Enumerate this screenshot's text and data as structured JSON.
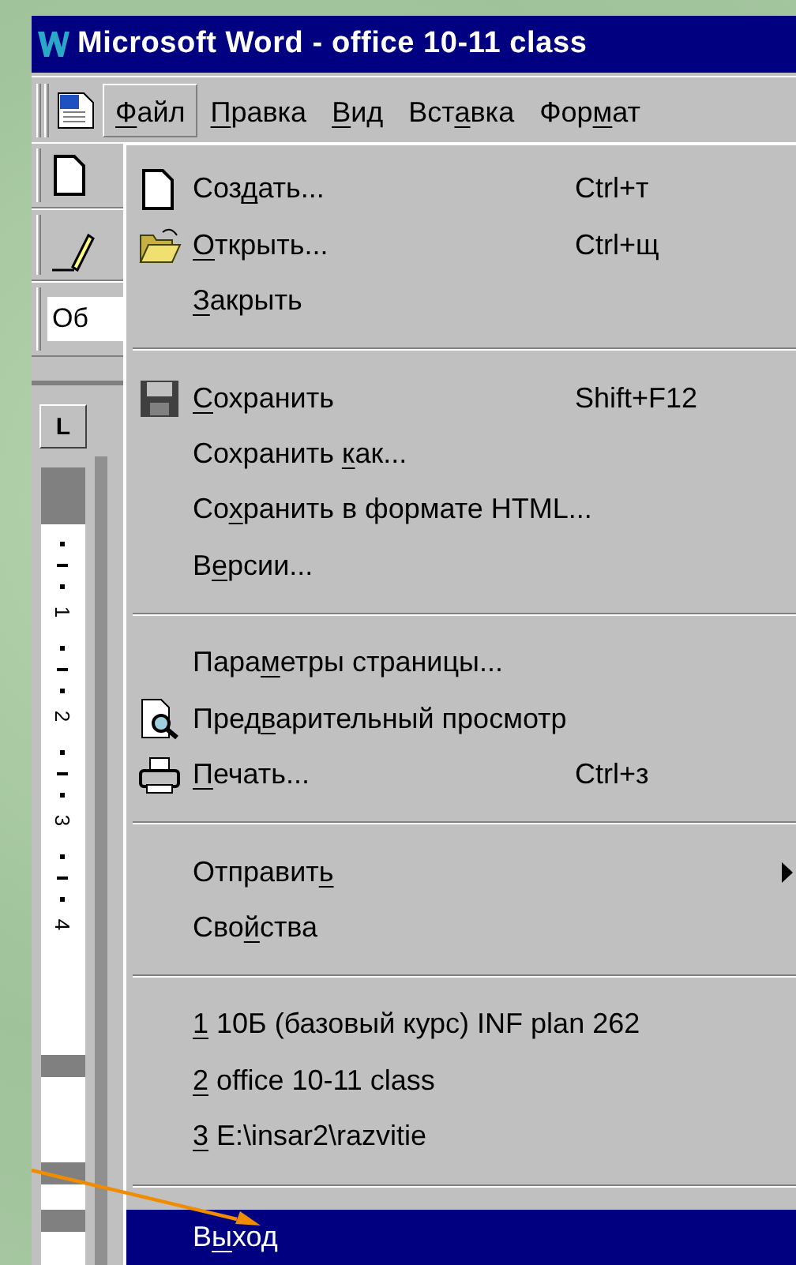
{
  "window": {
    "title": "Microsoft Word - office 10-11 class"
  },
  "menu_bar": [
    {
      "key": "Ф",
      "post": "айл",
      "selected": true
    },
    {
      "key": "П",
      "post": "равка",
      "selected": false
    },
    {
      "key": "В",
      "post": "ид",
      "selected": false
    },
    {
      "pre": "Вст",
      "key": "а",
      "post": "вка",
      "selected": false
    },
    {
      "pre": "Фор",
      "key": "м",
      "post": "ат",
      "selected": false
    }
  ],
  "format_field": {
    "value": "Об"
  },
  "ruler": {
    "tab_button": "L",
    "numbers": [
      "1",
      "2",
      "3",
      "4"
    ]
  },
  "file_menu": [
    {
      "kind": "item",
      "pre": "Соз",
      "key": "д",
      "post": "ать...",
      "shortcut": "Ctrl+т",
      "submenu": false,
      "selected": false
    },
    {
      "kind": "item",
      "key": "О",
      "post": "ткрыть...",
      "shortcut": "Ctrl+щ",
      "submenu": false,
      "selected": false
    },
    {
      "kind": "item",
      "key": "З",
      "post": "акрыть",
      "submenu": false,
      "selected": false
    },
    {
      "kind": "separator"
    },
    {
      "kind": "item",
      "key": "С",
      "post": "охранить",
      "shortcut": "Shift+F12",
      "submenu": false,
      "selected": false
    },
    {
      "kind": "item",
      "pre": "Сохранить ",
      "key": "к",
      "post": "ак...",
      "submenu": false,
      "selected": false
    },
    {
      "kind": "item",
      "pre": "Со",
      "key": "х",
      "post": "ранить в формате HTML...",
      "submenu": false,
      "selected": false
    },
    {
      "kind": "item",
      "pre": "В",
      "key": "е",
      "post": "рсии...",
      "submenu": false,
      "selected": false
    },
    {
      "kind": "separator"
    },
    {
      "kind": "item",
      "pre": "Пара",
      "key": "м",
      "post": "етры страницы...",
      "submenu": false,
      "selected": false
    },
    {
      "kind": "item",
      "pre": "Пред",
      "key": "в",
      "post": "арительный просмотр",
      "submenu": false,
      "selected": false
    },
    {
      "kind": "item",
      "key": "П",
      "post": "ечать...",
      "shortcut": "Ctrl+з",
      "submenu": false,
      "selected": false
    },
    {
      "kind": "separator"
    },
    {
      "kind": "item",
      "pre": "Отправит",
      "key": "ь",
      "submenu": true,
      "selected": false
    },
    {
      "kind": "item",
      "pre": "Сво",
      "key": "й",
      "post": "ства",
      "submenu": false,
      "selected": false
    },
    {
      "kind": "separator"
    },
    {
      "kind": "item",
      "key": "1",
      "post": " 10Б (базовый курс) INF plan 262",
      "submenu": false,
      "selected": false
    },
    {
      "kind": "item",
      "key": "2",
      "post": " office 10-11 class",
      "submenu": false,
      "selected": false
    },
    {
      "kind": "item",
      "key": "3",
      "post": " E:\\insar2\\razvitie",
      "submenu": false,
      "selected": false
    },
    {
      "kind": "separator"
    },
    {
      "kind": "item",
      "pre": "В",
      "key": "ы",
      "post": "ход",
      "submenu": false,
      "selected": true
    }
  ]
}
